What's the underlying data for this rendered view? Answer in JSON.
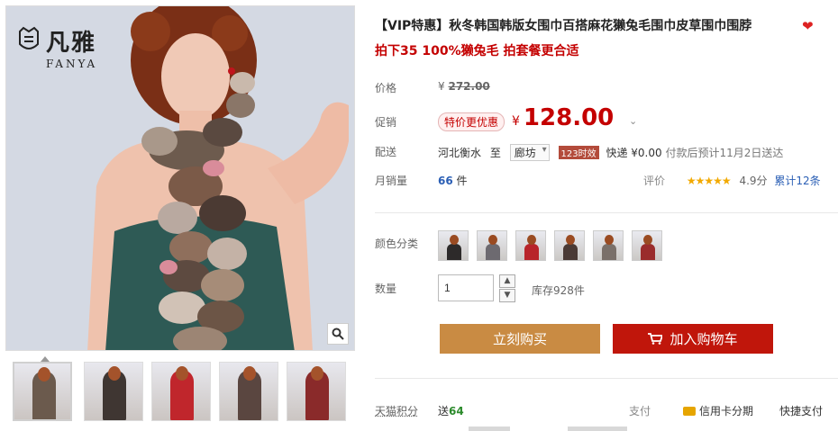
{
  "gallery": {
    "logo_cn": "凡雅",
    "logo_en": "FANYA",
    "zoom_icon": "magnifier-icon",
    "thumbnails": [
      {
        "scarf": "#6b5a4d"
      },
      {
        "scarf": "#3f3632"
      },
      {
        "scarf": "#c0262c"
      },
      {
        "scarf": "#5a4640"
      },
      {
        "scarf": "#8a2a2a"
      }
    ]
  },
  "product": {
    "title": "【VIP特惠】秋冬韩国韩版女围巾百搭麻花獭兔毛围巾皮草围巾围脖",
    "heart_icon": "heart-icon",
    "subtitle": "拍下35 100%獭兔毛 拍套餐更合适"
  },
  "price": {
    "label": "价格",
    "currency": "¥",
    "original": "272.00"
  },
  "promo": {
    "label": "促销",
    "tag": "特价更优惠",
    "currency": "¥",
    "price": "128.00",
    "caret_icon": "chevron-down-icon"
  },
  "delivery": {
    "label": "配送",
    "from": "河北衡水",
    "to_word": "至",
    "destination": "廊坊",
    "badge": "123时效",
    "fee": "快递 ¥0.00",
    "eta": "付款后预计11月2日送达"
  },
  "sales": {
    "label": "月销量",
    "count": "66",
    "unit": "件",
    "rating_label": "评价",
    "stars": "★★★★★",
    "score": "4.9分",
    "reviews_link": "累计12条"
  },
  "options": {
    "label": "颜色分类",
    "swatches": [
      {
        "color": "#2d2a2a"
      },
      {
        "color": "#6d6a70"
      },
      {
        "color": "#b8242a"
      },
      {
        "color": "#4a3a35"
      },
      {
        "color": "#7a706a"
      },
      {
        "color": "#9a2c2c"
      }
    ]
  },
  "quantity": {
    "label": "数量",
    "value": "1",
    "up_icon": "▲",
    "down_icon": "▼",
    "stock": "库存928件"
  },
  "actions": {
    "buy_now": "立刻购买",
    "add_to_cart": "加入购物车",
    "buy_color": "#c98b43",
    "cart_color": "#c0160b"
  },
  "footer": {
    "tmall_label": "天猫积分",
    "points_prefix": "送",
    "points_value": "64",
    "pay_label": "支付",
    "credit_installment": "信用卡分期",
    "quick_pay": "快捷支付"
  },
  "colors": {
    "accent_red": "#c40000",
    "link_blue": "#2b5fb5",
    "star": "#f2a900"
  }
}
